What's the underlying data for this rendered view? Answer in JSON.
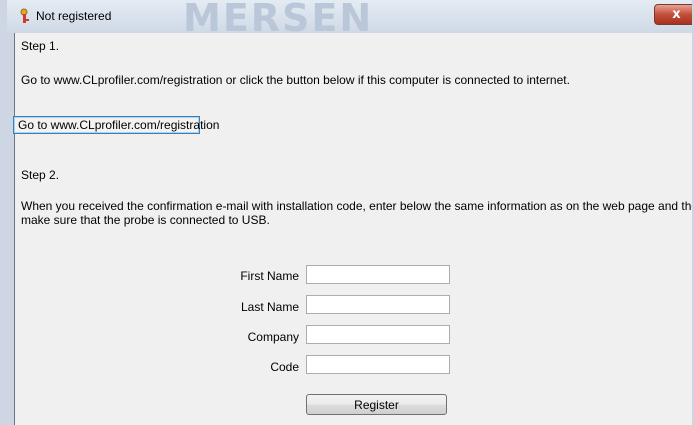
{
  "window": {
    "title": "Not registered",
    "brand": "MERSEN",
    "close_label": "x"
  },
  "step1": {
    "heading": "Step 1.",
    "instruction": "Go to www.CLprofiler.com/registration or click the button below if this computer is connected to internet.",
    "link_button": "Go to www.CLprofiler.com/registration"
  },
  "step2": {
    "heading": "Step 2.",
    "instruction_line1": "When you received the confirmation e-mail with installation code, enter below the same information as on the web page and the installation code.",
    "instruction_line2": "make sure that the probe is connected to USB."
  },
  "form": {
    "first_name_label": "First Name",
    "first_name_value": "",
    "last_name_label": "Last Name",
    "last_name_value": "",
    "company_label": "Company",
    "company_value": "",
    "code_label": "Code",
    "code_value": "",
    "register_label": "Register"
  },
  "icons": {
    "app": "key-icon",
    "close": "close-icon"
  },
  "colors": {
    "close_button": "#c24f3b",
    "focus_border": "#3c7fb1"
  }
}
